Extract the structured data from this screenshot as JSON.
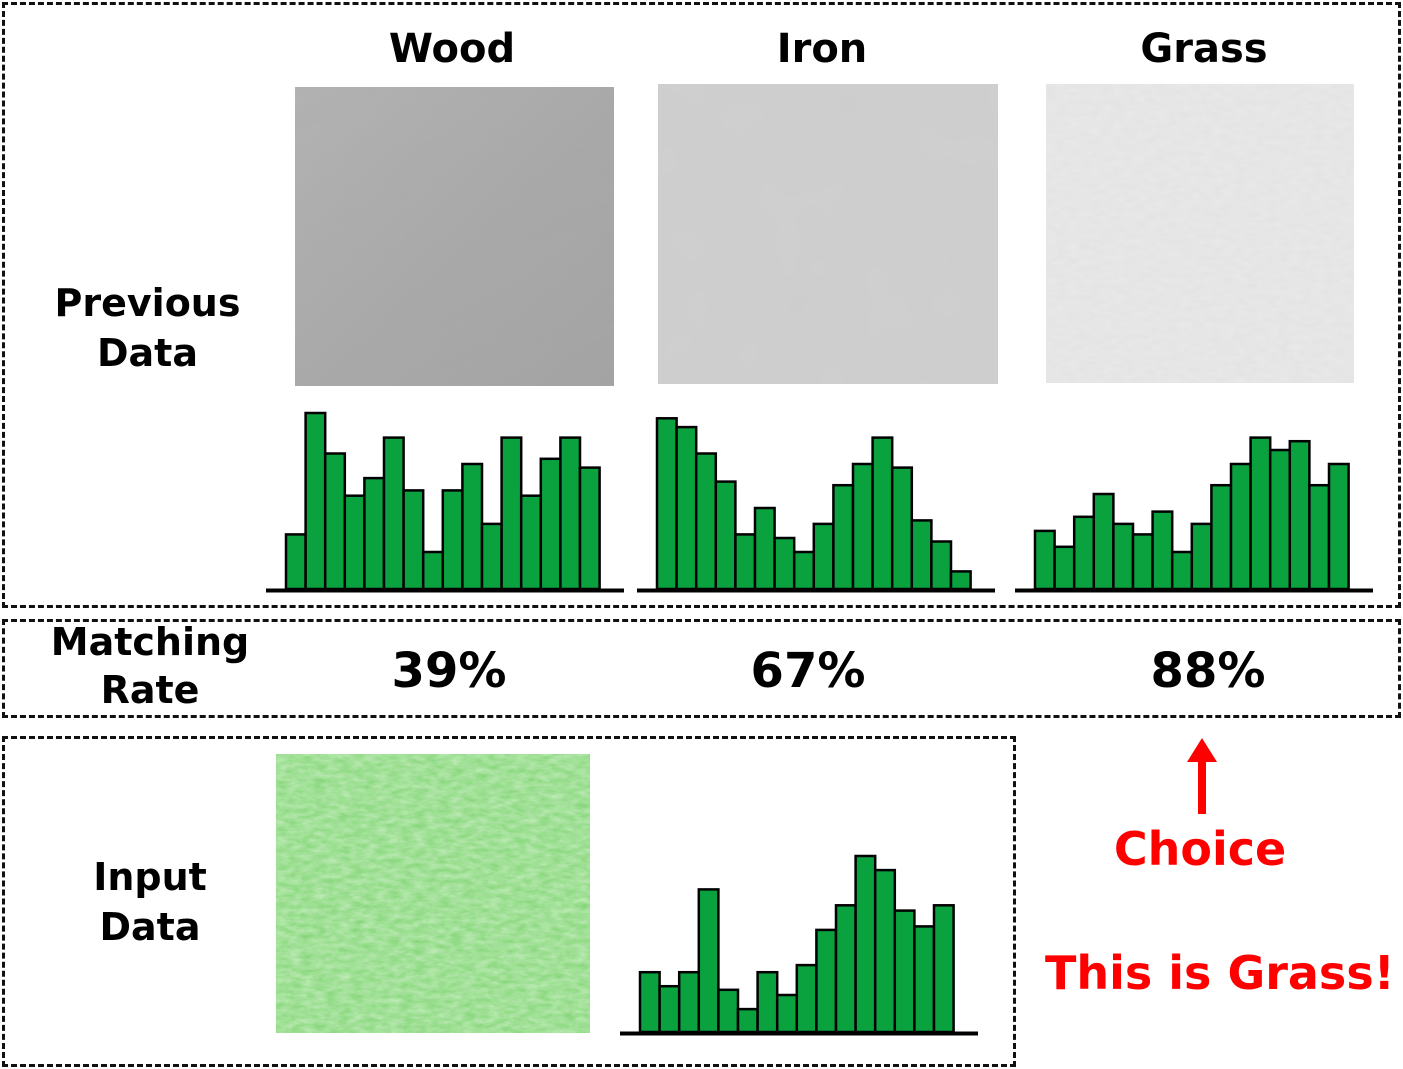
{
  "row_labels": {
    "previous": [
      "Previous",
      "Data"
    ],
    "matching": [
      "Matching",
      "Rate"
    ],
    "input": [
      "Input",
      "Data"
    ]
  },
  "columns": [
    {
      "title": "Wood",
      "rate": "39%"
    },
    {
      "title": "Iron",
      "rate": "67%"
    },
    {
      "title": "Grass",
      "rate": "88%"
    }
  ],
  "choice_label": "Choice",
  "result_label": "This is Grass!",
  "colors": {
    "bar_fill": "#0aa23e",
    "bar_stroke": "#000000",
    "highlight": "#ff0000"
  },
  "textures": [
    "wood-texture-image",
    "iron-texture-image",
    "grass-texture-image",
    "input-grass-texture-image"
  ],
  "histograms": {
    "wood": [
      0.31,
      1.0,
      0.77,
      0.53,
      0.63,
      0.86,
      0.56,
      0.21,
      0.56,
      0.71,
      0.37,
      0.86,
      0.53,
      0.74,
      0.86,
      0.69
    ],
    "iron": [
      0.97,
      0.92,
      0.77,
      0.61,
      0.31,
      0.46,
      0.29,
      0.21,
      0.37,
      0.59,
      0.71,
      0.86,
      0.69,
      0.39,
      0.27,
      0.1
    ],
    "grass": [
      0.33,
      0.24,
      0.41,
      0.54,
      0.37,
      0.31,
      0.44,
      0.21,
      0.37,
      0.59,
      0.71,
      0.86,
      0.79,
      0.84,
      0.59,
      0.71
    ],
    "input": [
      0.34,
      0.26,
      0.34,
      0.81,
      0.24,
      0.13,
      0.34,
      0.21,
      0.38,
      0.58,
      0.72,
      1.0,
      0.92,
      0.69,
      0.6,
      0.72
    ]
  }
}
